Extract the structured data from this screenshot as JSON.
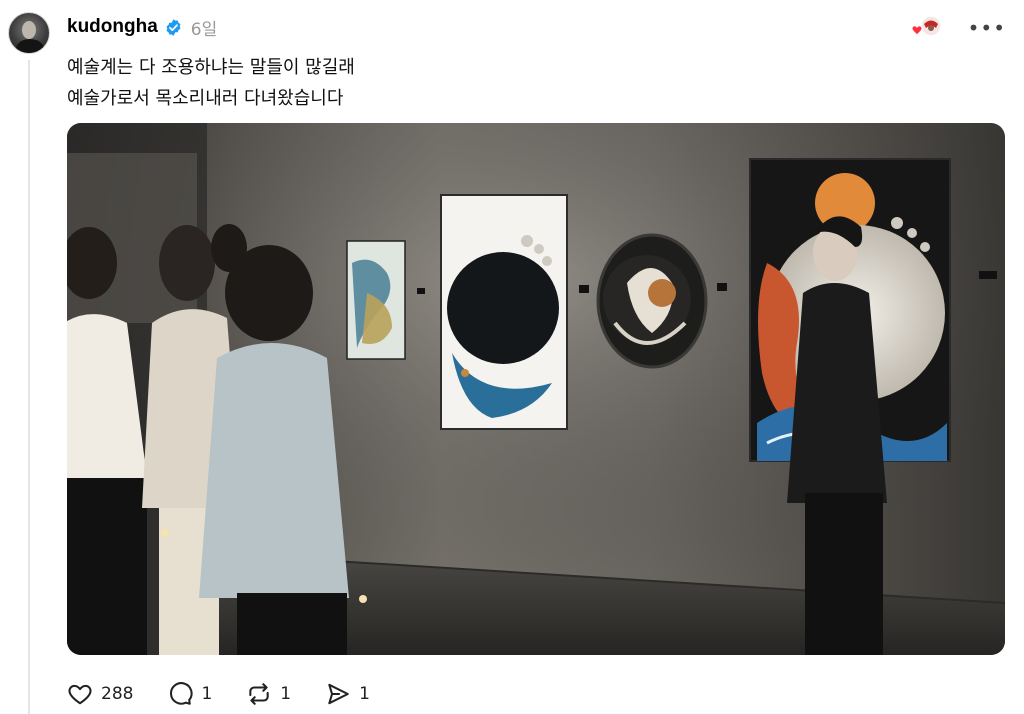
{
  "post": {
    "username": "kudongha",
    "verified": true,
    "time": "6일",
    "text_lines": [
      "예술계는 다 조용하냐는 말들이 많길래",
      "예술가로서 목소리내러 다녀왔습니다"
    ]
  },
  "actions": {
    "likes": "288",
    "replies": "1",
    "reposts": "1",
    "shares": "1"
  },
  "icons": [
    "verified-badge-icon",
    "heart-icon",
    "comment-icon",
    "repost-icon",
    "share-icon",
    "more-icon"
  ],
  "colors": {
    "verified_blue": "#1d9bf0",
    "text": "#000000",
    "muted": "#999999"
  }
}
